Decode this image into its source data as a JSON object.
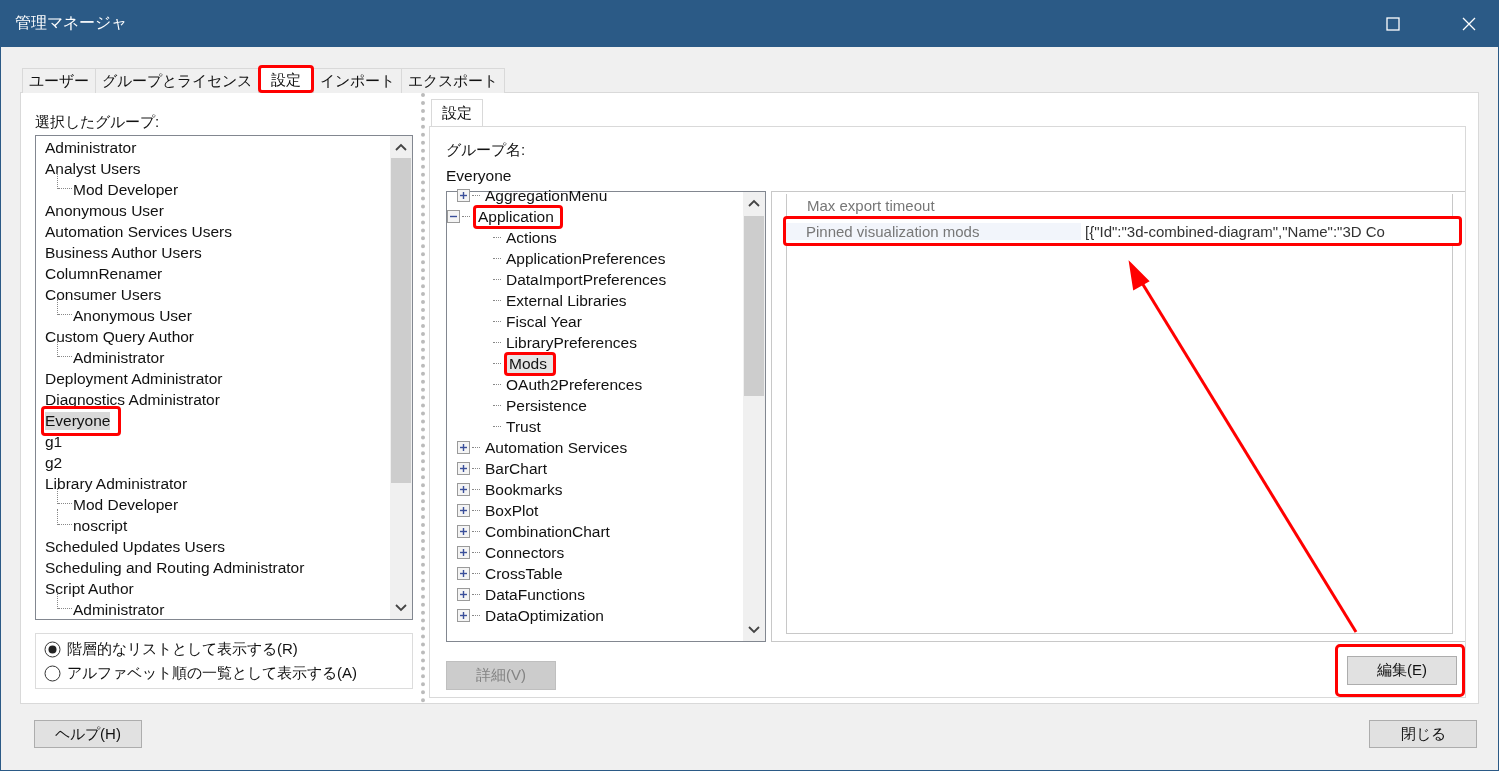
{
  "window": {
    "title": "管理マネージャ"
  },
  "tabs": [
    {
      "label": "ユーザー",
      "selected": false,
      "highlighted": false
    },
    {
      "label": "グループとライセンス",
      "selected": false,
      "highlighted": false
    },
    {
      "label": "設定",
      "selected": true,
      "highlighted": true
    },
    {
      "label": "インポート",
      "selected": false,
      "highlighted": false
    },
    {
      "label": "エクスポート",
      "selected": false,
      "highlighted": false
    }
  ],
  "groups": {
    "label": "選択したグループ:",
    "items": [
      {
        "label": "Administrator",
        "selected": false,
        "highlighted": false
      },
      {
        "label": "Analyst Users",
        "selected": false,
        "highlighted": false,
        "children": [
          {
            "label": "Mod Developer"
          }
        ]
      },
      {
        "label": "Anonymous User",
        "selected": false,
        "highlighted": false
      },
      {
        "label": "Automation Services Users",
        "selected": false,
        "highlighted": false
      },
      {
        "label": "Business Author Users",
        "selected": false,
        "highlighted": false
      },
      {
        "label": "ColumnRenamer",
        "selected": false,
        "highlighted": false
      },
      {
        "label": "Consumer Users",
        "selected": false,
        "highlighted": false,
        "children": [
          {
            "label": "Anonymous User"
          }
        ]
      },
      {
        "label": "Custom Query Author",
        "selected": false,
        "highlighted": false,
        "children": [
          {
            "label": "Administrator"
          }
        ]
      },
      {
        "label": "Deployment Administrator",
        "selected": false,
        "highlighted": false
      },
      {
        "label": "Diagnostics Administrator",
        "selected": false,
        "highlighted": false
      },
      {
        "label": "Everyone",
        "selected": true,
        "highlighted": true
      },
      {
        "label": "g1",
        "selected": false,
        "highlighted": false
      },
      {
        "label": "g2",
        "selected": false,
        "highlighted": false
      },
      {
        "label": "Library Administrator",
        "selected": false,
        "highlighted": false,
        "children": [
          {
            "label": "Mod Developer"
          },
          {
            "label": "noscript"
          }
        ]
      },
      {
        "label": "Scheduled Updates Users",
        "selected": false,
        "highlighted": false
      },
      {
        "label": "Scheduling and Routing Administrator",
        "selected": false,
        "highlighted": false
      },
      {
        "label": "Script Author",
        "selected": false,
        "highlighted": false,
        "children": [
          {
            "label": "Administrator"
          }
        ]
      }
    ]
  },
  "view_options": [
    {
      "label": "階層的なリストとして表示する(R)",
      "selected": true
    },
    {
      "label": "アルファベット順の一覧として表示する(A)",
      "selected": false
    }
  ],
  "settings_tab": {
    "label": "設定"
  },
  "group_name": {
    "label": "グループ名:",
    "value": "Everyone"
  },
  "tree": [
    {
      "label": "AggregationMenu",
      "expanded": false,
      "selected": false,
      "highlighted": false
    },
    {
      "label": "Application",
      "expanded": true,
      "selected": false,
      "highlighted": true,
      "children": [
        {
          "label": "Actions",
          "selected": false,
          "highlighted": false
        },
        {
          "label": "ApplicationPreferences",
          "selected": false,
          "highlighted": false
        },
        {
          "label": "DataImportPreferences",
          "selected": false,
          "highlighted": false
        },
        {
          "label": "External Libraries",
          "selected": false,
          "highlighted": false
        },
        {
          "label": "Fiscal Year",
          "selected": false,
          "highlighted": false
        },
        {
          "label": "LibraryPreferences",
          "selected": false,
          "highlighted": false
        },
        {
          "label": "Mods",
          "selected": true,
          "highlighted": true
        },
        {
          "label": "OAuth2Preferences",
          "selected": false,
          "highlighted": false
        },
        {
          "label": "Persistence",
          "selected": false,
          "highlighted": false
        },
        {
          "label": "Trust",
          "selected": false,
          "highlighted": false
        }
      ]
    },
    {
      "label": "Automation Services",
      "expanded": false,
      "selected": false,
      "highlighted": false
    },
    {
      "label": "BarChart",
      "expanded": false,
      "selected": false,
      "highlighted": false
    },
    {
      "label": "Bookmarks",
      "expanded": false,
      "selected": false,
      "highlighted": false
    },
    {
      "label": "BoxPlot",
      "expanded": false,
      "selected": false,
      "highlighted": false
    },
    {
      "label": "CombinationChart",
      "expanded": false,
      "selected": false,
      "highlighted": false
    },
    {
      "label": "Connectors",
      "expanded": false,
      "selected": false,
      "highlighted": false
    },
    {
      "label": "CrossTable",
      "expanded": false,
      "selected": false,
      "highlighted": false
    },
    {
      "label": "DataFunctions",
      "expanded": false,
      "selected": false,
      "highlighted": false
    },
    {
      "label": "DataOptimization",
      "expanded": false,
      "selected": false,
      "highlighted": false
    }
  ],
  "properties": [
    {
      "name": "Max export timeout",
      "selected": false,
      "highlighted": false
    },
    {
      "name": "Pinned visualization mods",
      "value": "[{\"Id\":\"3d-combined-diagram\",\"Name\":\"3D Co",
      "selected": true,
      "highlighted": true
    }
  ],
  "buttons": {
    "details": {
      "label": "詳細(V)",
      "disabled": true
    },
    "edit": {
      "label": "編集(E)",
      "disabled": false,
      "highlighted": true
    },
    "help": {
      "label": "ヘルプ(H)"
    },
    "close": {
      "label": "閉じる"
    }
  },
  "annotation_arrow": true
}
